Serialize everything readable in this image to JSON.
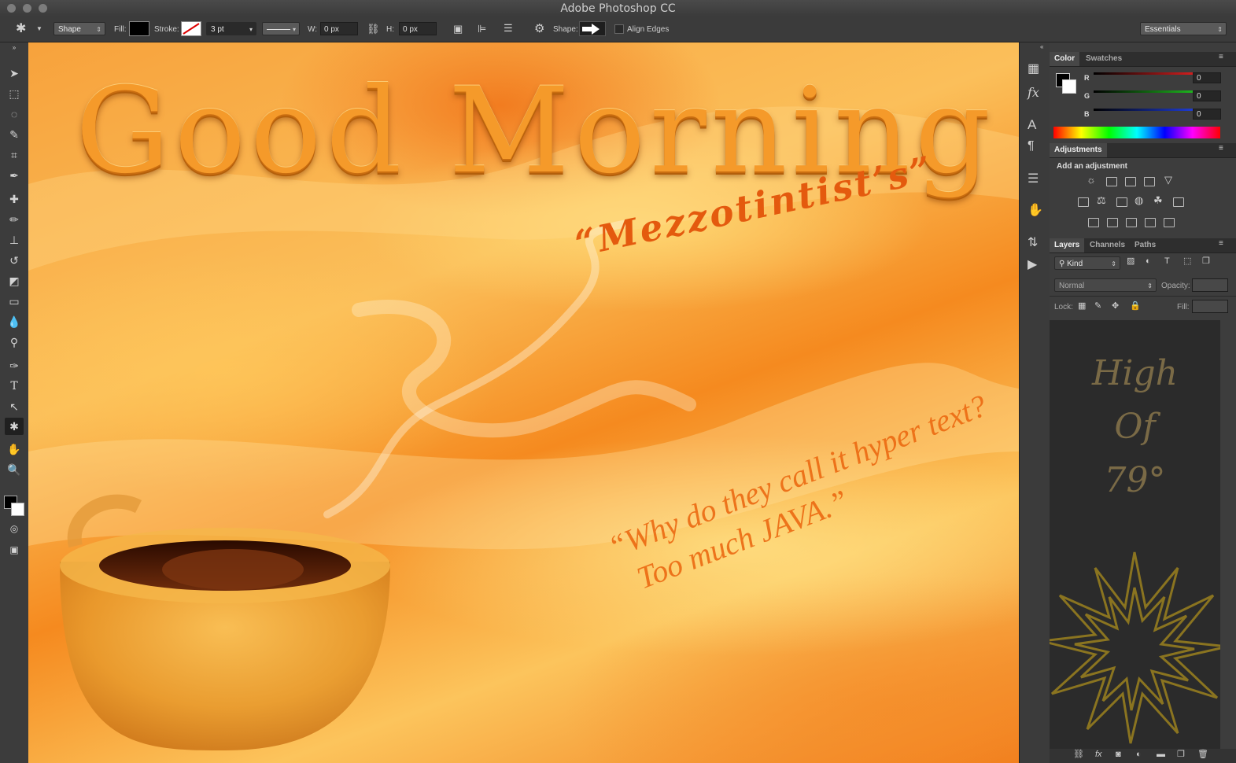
{
  "window": {
    "title": "Adobe Photoshop CC"
  },
  "options_bar": {
    "mode": "Shape",
    "fill_label": "Fill:",
    "stroke_label": "Stroke:",
    "stroke_width": "3 pt",
    "w_label": "W:",
    "w_value": "0 px",
    "h_label": "H:",
    "h_value": "0 px",
    "shape_label": "Shape:",
    "align_edges": "Align Edges",
    "workspace": "Essentials"
  },
  "canvas": {
    "headline": "Good Morning",
    "subtitle": "“Mezzotintist’s”",
    "joke_line1": "“Why do they call it hyper text?",
    "joke_line2": "Too much JAVA.”"
  },
  "color_panel": {
    "tabs": [
      "Color",
      "Swatches"
    ],
    "channels": [
      {
        "label": "R",
        "value": "0",
        "color": "#e02020"
      },
      {
        "label": "G",
        "value": "0",
        "color": "#20c020"
      },
      {
        "label": "B",
        "value": "0",
        "color": "#2040e0"
      }
    ]
  },
  "adjustments_panel": {
    "tab": "Adjustments",
    "heading": "Add an adjustment"
  },
  "layers_panel": {
    "tabs": [
      "Layers",
      "Channels",
      "Paths"
    ],
    "filter": "Kind",
    "blend_mode": "Normal",
    "opacity_label": "Opacity:",
    "lock_label": "Lock:",
    "fill_label": "Fill:",
    "preview_line1": "High",
    "preview_line2": "Of",
    "preview_line3": "79°"
  }
}
